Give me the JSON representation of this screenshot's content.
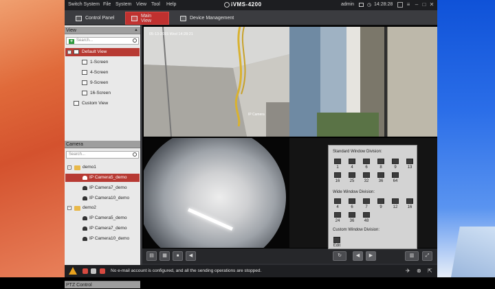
{
  "menubar": {
    "items": [
      "Switch System",
      "File",
      "System",
      "View",
      "Tool",
      "Help"
    ],
    "app_name": "iVMS-4200",
    "user": "admin",
    "time": "14:28:28"
  },
  "tabs": [
    {
      "label": "Control Panel",
      "active": false
    },
    {
      "label": "Main View",
      "active": true
    },
    {
      "label": "Device Management",
      "active": false
    }
  ],
  "view_panel": {
    "title": "View",
    "search_placeholder": "Search...",
    "items": [
      {
        "label": "Default View",
        "level": 0,
        "selected": true
      },
      {
        "label": "1-Screen",
        "level": 1
      },
      {
        "label": "4-Screen",
        "level": 1
      },
      {
        "label": "9-Screen",
        "level": 1
      },
      {
        "label": "16-Screen",
        "level": 1
      },
      {
        "label": "Custom View",
        "level": 0
      }
    ]
  },
  "camera_panel": {
    "title": "Camera",
    "search_placeholder": "Search...",
    "groups": [
      {
        "label": "demo1",
        "cameras": [
          "IP Camera5_demo",
          "IP Camera7_demo",
          "IP Camera10_demo"
        ],
        "selected_index": 0
      },
      {
        "label": "demo2",
        "cameras": [
          "IP Camera5_demo",
          "IP Camera7_demo",
          "IP Camera10_demo"
        ]
      }
    ]
  },
  "ptz_title": "PTZ Control",
  "video": {
    "tile1_osd": "05-13-2015 Wed 14:28:21",
    "tile1_camera": "IP Camera"
  },
  "window_division": {
    "standard_title": "Standard Window Division:",
    "standard_labels": [
      "1",
      "4",
      "6",
      "8",
      "9",
      "13",
      "16",
      "25",
      "32",
      "36",
      "64"
    ],
    "wide_title": "Wide Window Division:",
    "wide_labels": [
      "4",
      "6",
      "7",
      "9",
      "12",
      "16",
      "24",
      "36",
      "48"
    ],
    "custom_title": "Custom Window Division:",
    "edit_label": "Edit"
  },
  "status": {
    "message": "No e-mail account is configured, and all the sending operations are stopped."
  }
}
